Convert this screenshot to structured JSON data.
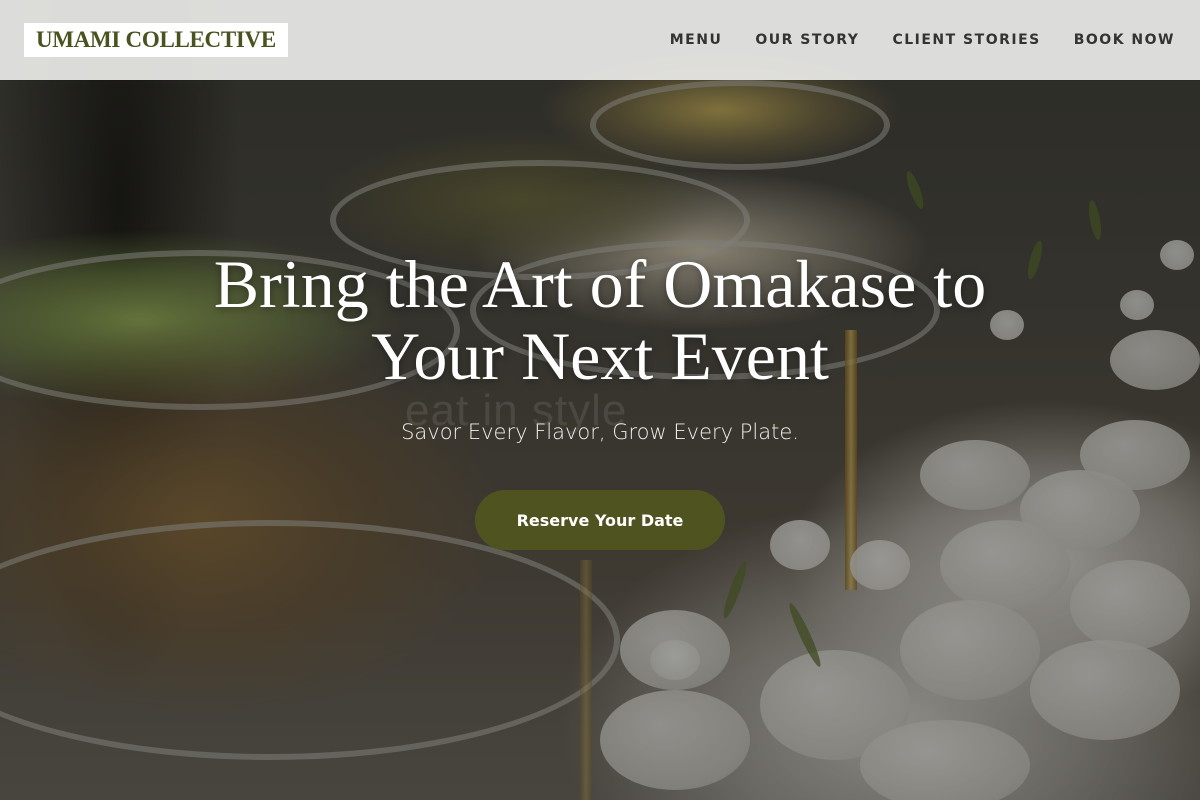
{
  "brand": {
    "logo_text": "UMAMI COLLECTIVE",
    "logo_color": "#4a5320"
  },
  "nav": {
    "items": [
      {
        "label": "MENU"
      },
      {
        "label": "OUR STORY"
      },
      {
        "label": "CLIENT STORIES"
      },
      {
        "label": "BOOK NOW"
      }
    ]
  },
  "hero": {
    "headline_line1": "Bring the Art of Omakase to",
    "headline_line2": "Your Next Event",
    "tagline": "Savor Every Flavor, Grow Every Plate.",
    "cta_label": "Reserve Your Date",
    "cta_color": "#4f5320",
    "background_image": "catering-buffet-photo"
  }
}
